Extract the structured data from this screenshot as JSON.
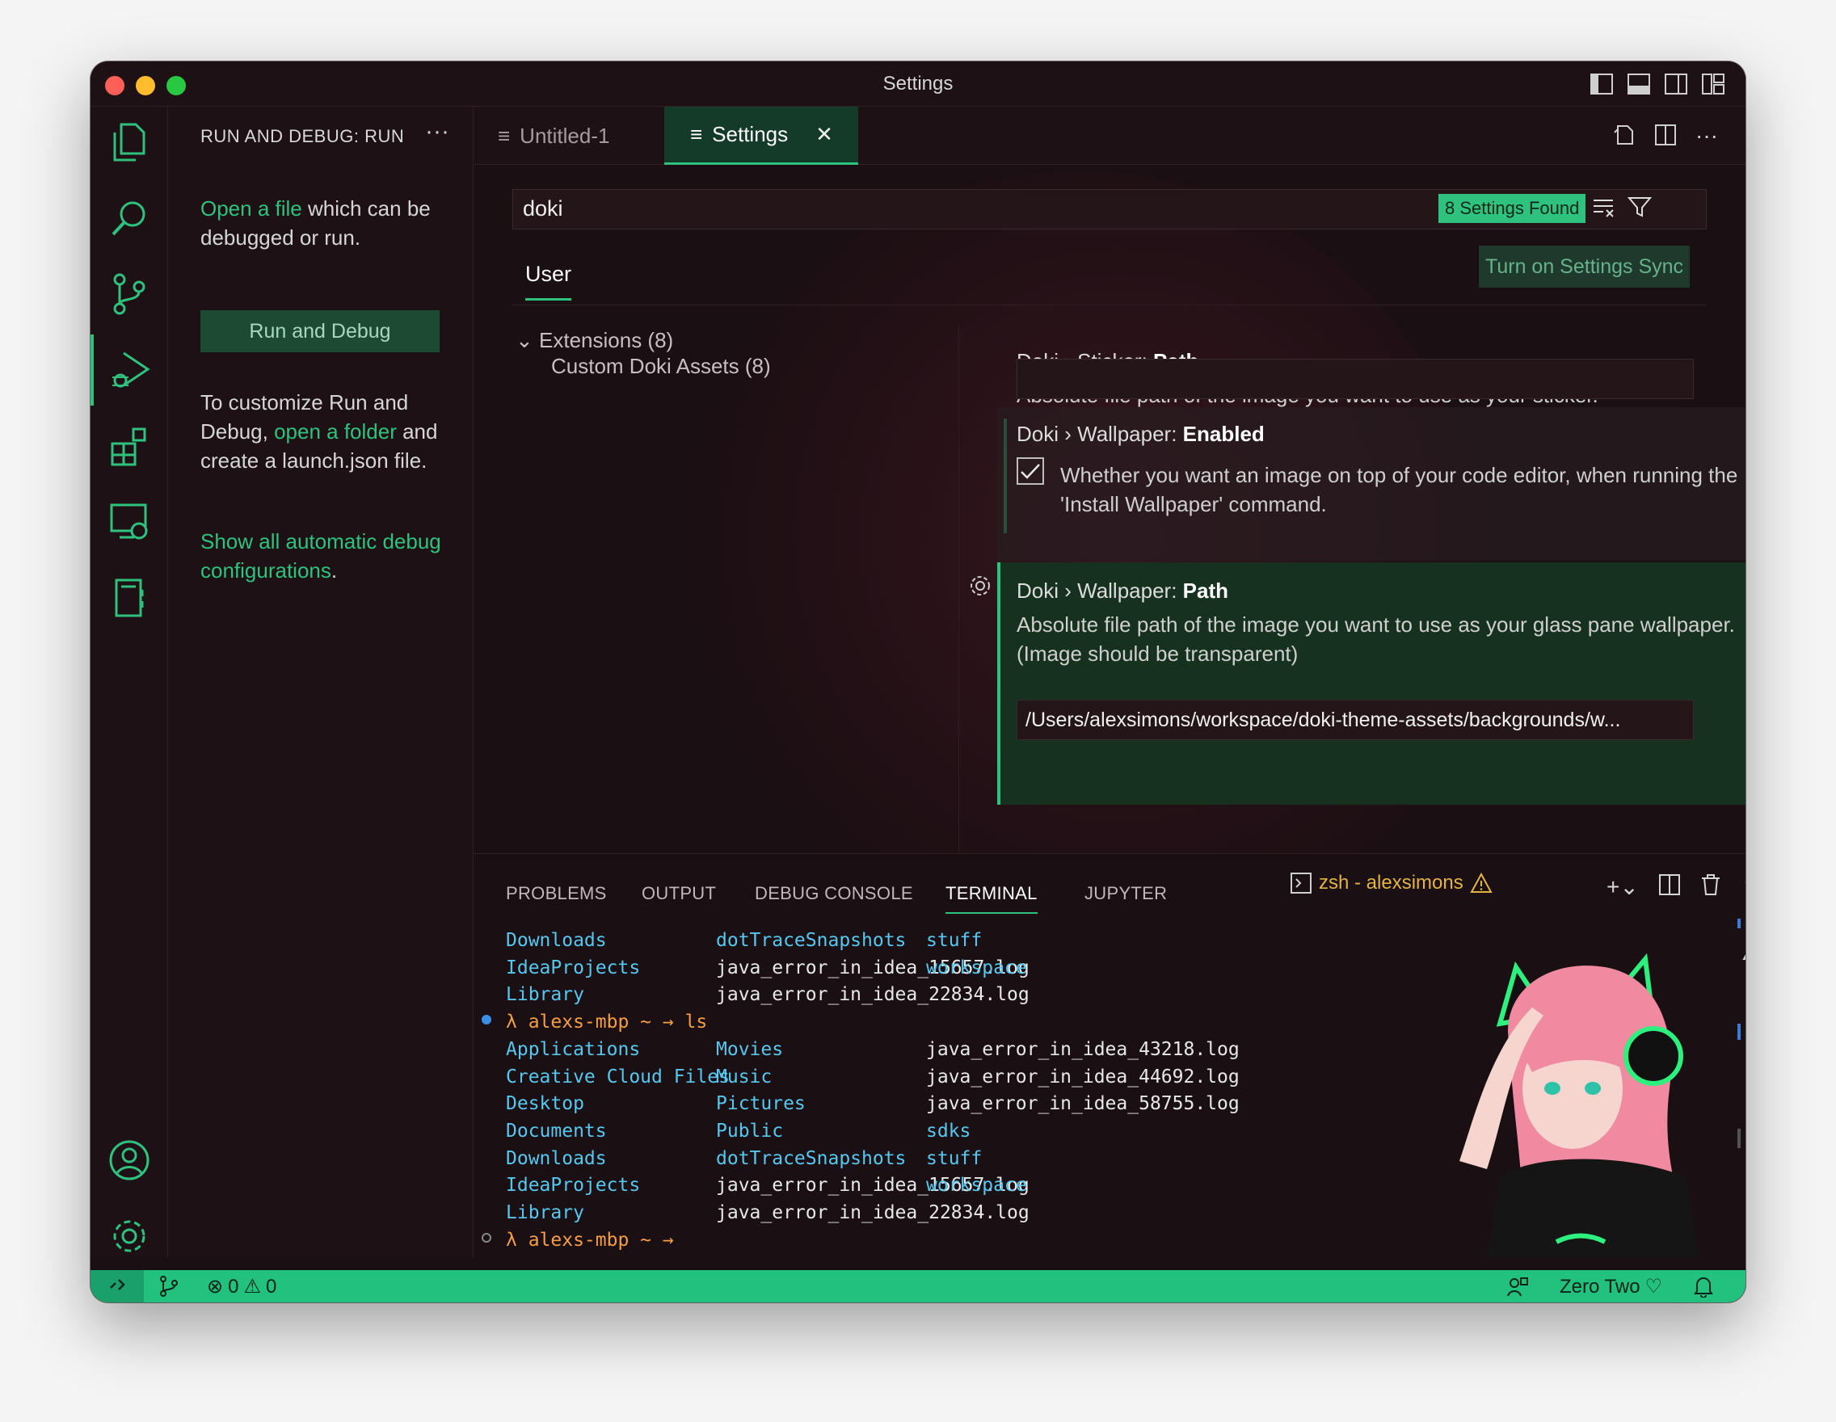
{
  "window": {
    "title": "Settings"
  },
  "sidebar": {
    "header": "RUN AND DEBUG: RUN",
    "open_file_link": "Open a file",
    "open_file_rest": " which can be debugged or run.",
    "run_button": "Run and Debug",
    "customize_pre": "To customize Run and Debug, ",
    "open_folder_link": "open a folder",
    "customize_post": " and create a launch.json file.",
    "show_all_link": "Show all automatic debug configurations",
    "show_all_period": "."
  },
  "editor": {
    "tabs": [
      {
        "label": "Untitled-1"
      },
      {
        "label": "Settings"
      }
    ],
    "search": {
      "value": "doki"
    },
    "found_badge": "8 Settings Found",
    "user_tab": "User",
    "sync_button": "Turn on Settings Sync",
    "toc": {
      "extensions": "Extensions (8)",
      "custom_assets": "Custom Doki Assets (8)"
    },
    "settings": [
      {
        "prefix": "Doki › Sticker: ",
        "name": "Path",
        "description": "Absolute file path of the image you want to use as your sticker."
      },
      {
        "prefix": "Doki › Wallpaper: ",
        "name": "Enabled",
        "description": "Whether you want an image on top of your code editor, when running the 'Install Wallpaper' command."
      },
      {
        "prefix": "Doki › Wallpaper: ",
        "name": "Path",
        "description": "Absolute file path of the image you want to use as your glass pane wallpaper. (Image should be transparent)",
        "value": "/Users/alexsimons/workspace/doki-theme-assets/backgrounds/w..."
      }
    ]
  },
  "panel": {
    "tabs": [
      "PROBLEMS",
      "OUTPUT",
      "DEBUG CONSOLE",
      "TERMINAL",
      "JUPYTER"
    ],
    "terminal_name": "zsh - alexsimons",
    "terminal": {
      "block1": [
        [
          "Downloads",
          "dotTraceSnapshots",
          "stuff"
        ],
        [
          "IdeaProjects",
          "java_error_in_idea_15657.log",
          "workspace"
        ],
        [
          "Library",
          "java_error_in_idea_22834.log",
          ""
        ]
      ],
      "prompt1": "λ alexs-mbp ~ → ls",
      "block2": [
        [
          "Applications",
          "Movies",
          "java_error_in_idea_43218.log"
        ],
        [
          "Creative Cloud Files",
          "Music",
          "java_error_in_idea_44692.log"
        ],
        [
          "Desktop",
          "Pictures",
          "java_error_in_idea_58755.log"
        ],
        [
          "Documents",
          "Public",
          "sdks"
        ],
        [
          "Downloads",
          "dotTraceSnapshots",
          "stuff"
        ],
        [
          "IdeaProjects",
          "java_error_in_idea_15657.log",
          "workspace"
        ],
        [
          "Library",
          "java_error_in_idea_22834.log",
          ""
        ]
      ],
      "prompt2": "λ alexs-mbp ~ →"
    }
  },
  "statusbar": {
    "errors": "0",
    "warnings": "0",
    "theme_name": "Zero Two"
  },
  "colors": {
    "accent": "#2ec27e",
    "background": "#1a0f13",
    "statusbar": "#22c17e",
    "terminal_dir": "#56c8f0",
    "terminal_prompt": "#f59e44"
  }
}
